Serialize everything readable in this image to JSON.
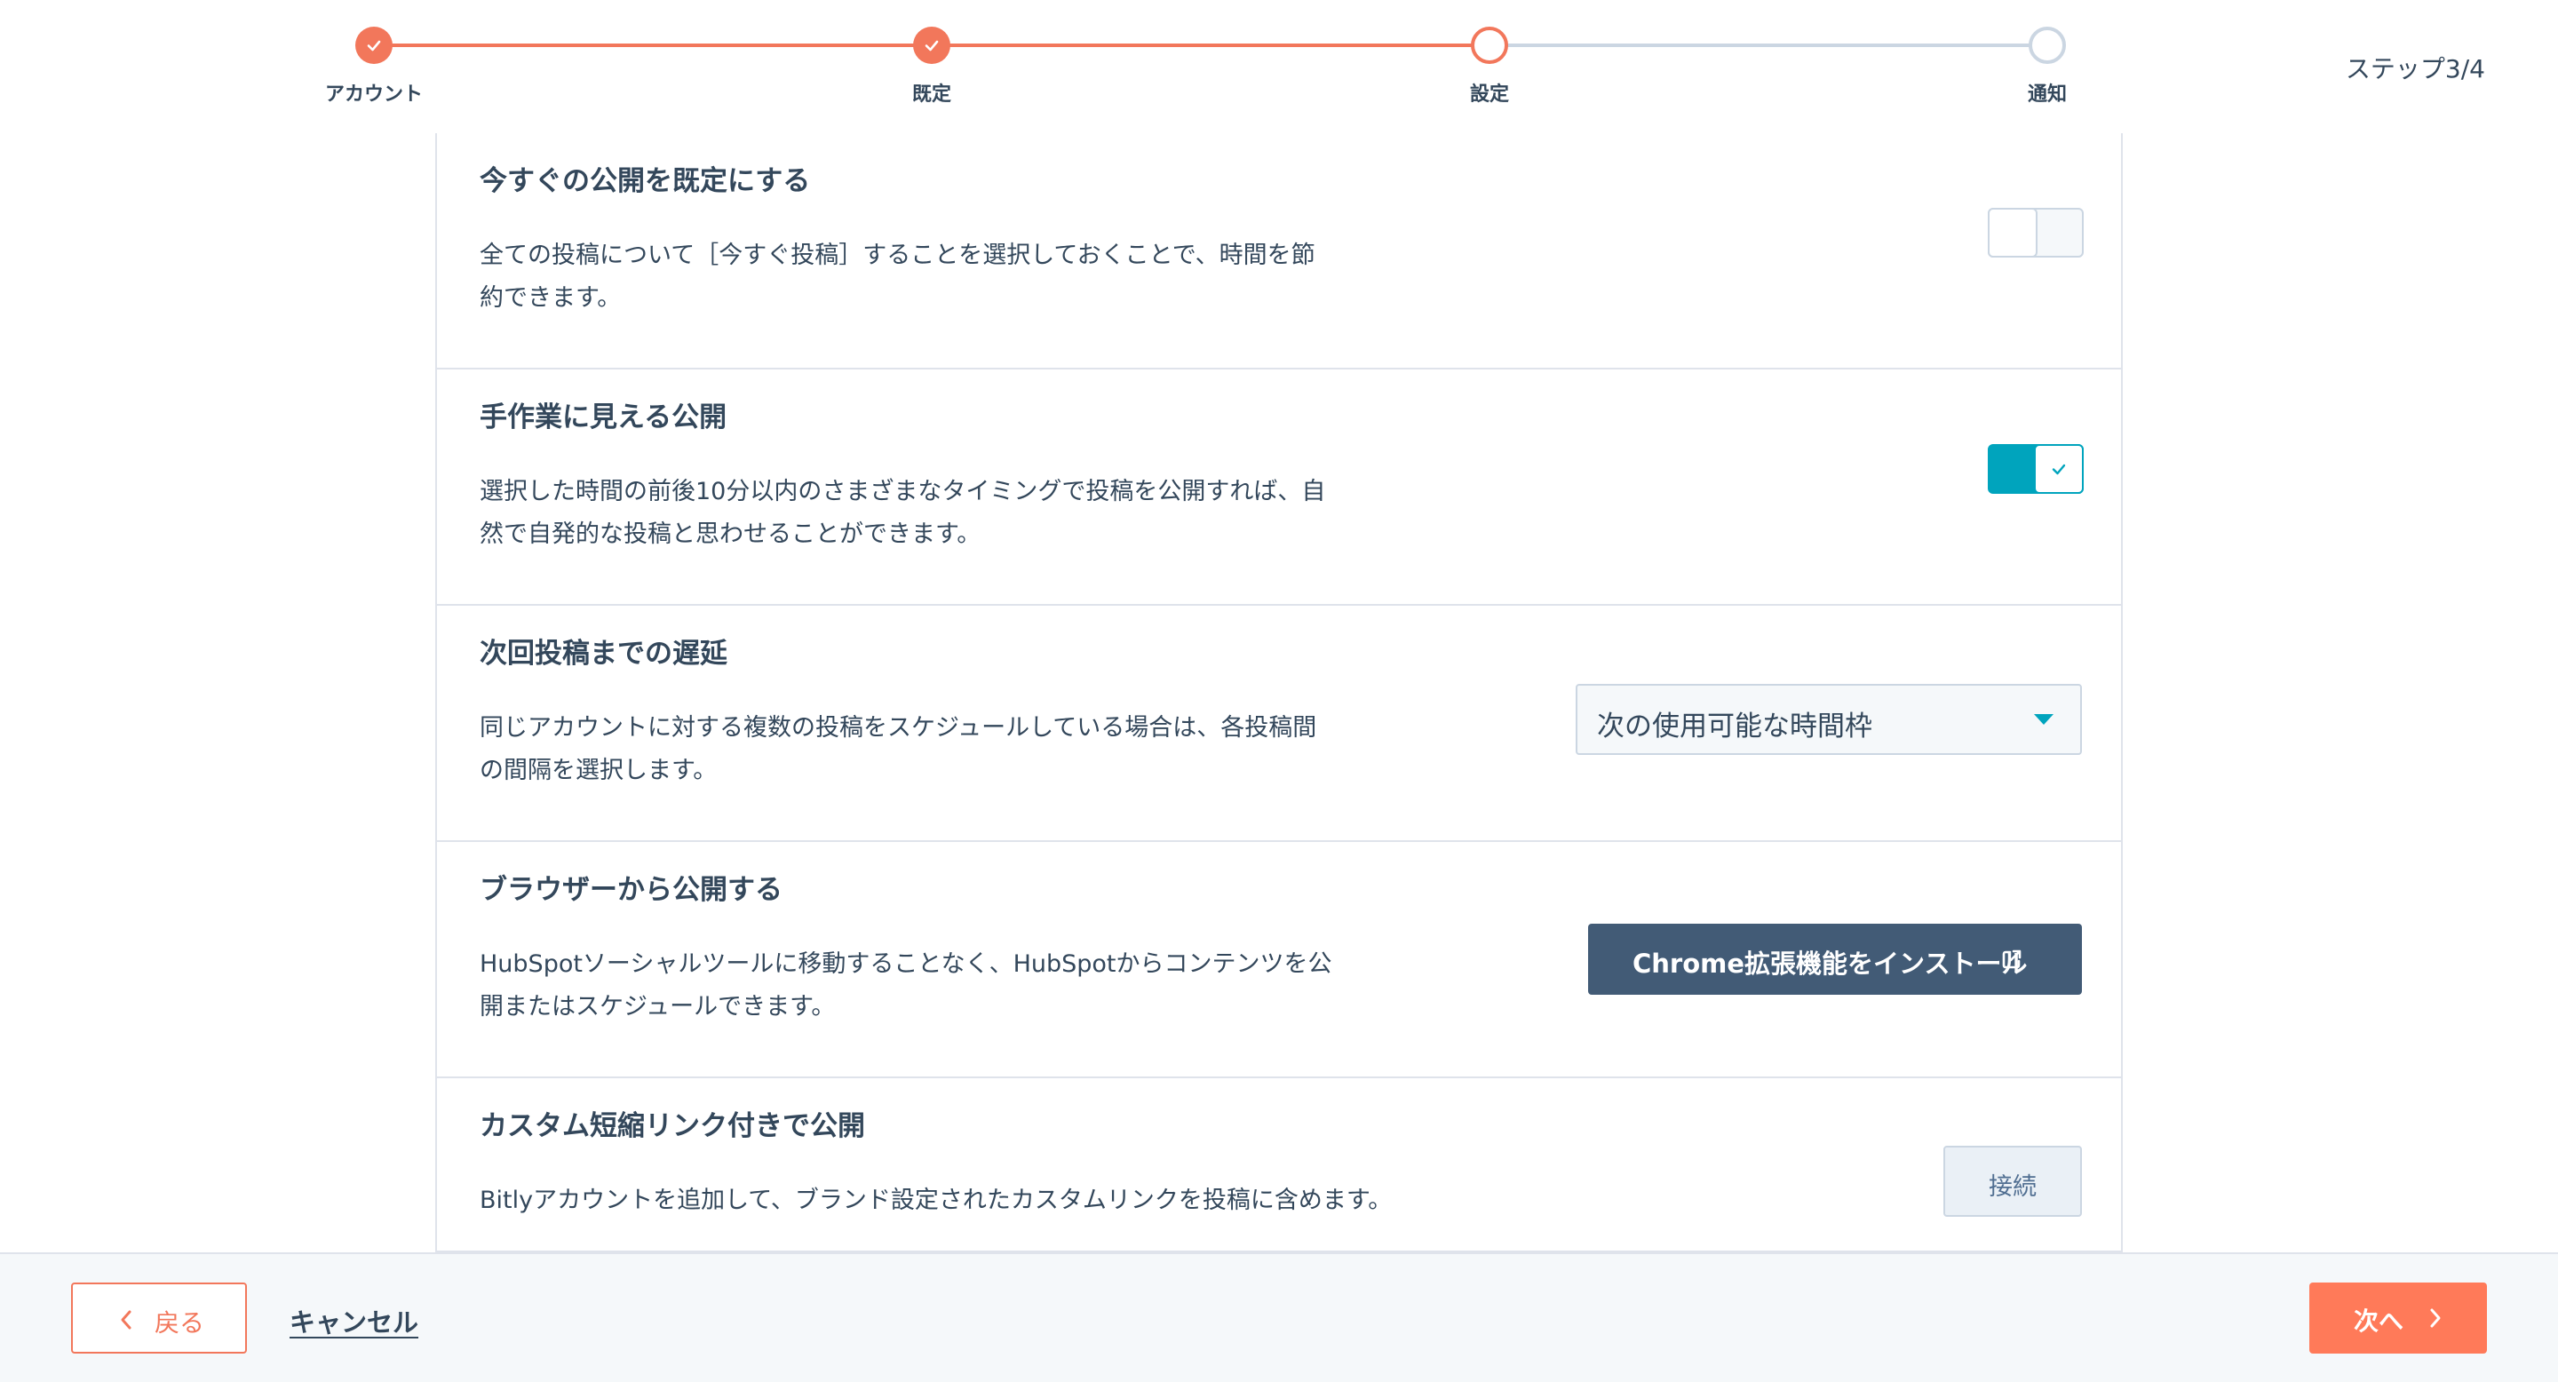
{
  "stepper": {
    "steps": [
      {
        "label": "アカウント",
        "state": "done"
      },
      {
        "label": "既定",
        "state": "done"
      },
      {
        "label": "設定",
        "state": "active"
      },
      {
        "label": "通知",
        "state": "todo"
      }
    ],
    "counter": "ステップ3/4"
  },
  "settings": {
    "publish_now": {
      "title": "今すぐの公開を既定にする",
      "desc_line1": "全ての投稿について［今すぐ投稿］することを選択しておくことで、時間を節",
      "desc_line2": "約できます。",
      "toggle_on": false
    },
    "manual_publish": {
      "title": "手作業に見える公開",
      "desc_line1": "選択した時間の前後10分以内のさまざまなタイミングで投稿を公開すれば、自",
      "desc_line2": "然で自発的な投稿と思わせることができます。",
      "toggle_on": true
    },
    "delay": {
      "title": "次回投稿までの遅延",
      "desc_line1": "同じアカウントに対する複数の投稿をスケジュールしている場合は、各投稿間",
      "desc_line2": "の間隔を選択します。",
      "selected_value": "次の使用可能な時間枠"
    },
    "browser": {
      "title": "ブラウザーから公開する",
      "desc_line1": "HubSpotソーシャルツールに移動することなく、HubSpotからコンテンツを公",
      "desc_line2": "開またはスケジュールできます。",
      "button_label": "Chrome拡張機能をインストール"
    },
    "shortlink": {
      "title": "カスタム短縮リンク付きで公開",
      "desc_line1": "Bitlyアカウントを追加して、ブランド設定されたカスタムリンクを投稿に含めます。",
      "button_label": "接続"
    }
  },
  "footer": {
    "back_label": "戻る",
    "cancel_label": "キャンセル",
    "next_label": "次へ"
  },
  "colors": {
    "accent_orange": "#ff7a59",
    "toggle_teal": "#00a4bd",
    "dark_button": "#425b76",
    "text": "#33475b"
  }
}
